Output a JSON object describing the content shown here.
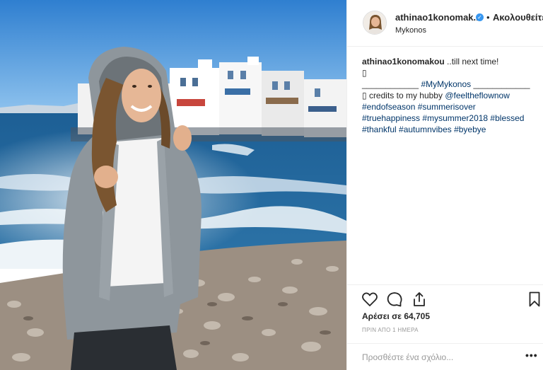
{
  "header": {
    "username": "athinao1konomak...",
    "verified_icon": "verified-check-icon",
    "separator": "•",
    "follow_label": "Ακολουθείτε",
    "location": "Mykonos"
  },
  "caption": {
    "username": "athinao1konomakou",
    "text": "..till next time!",
    "line2": "▯",
    "line3_pre": "____________",
    "line3_tag": "#MyMykonos",
    "line3_post": "____________",
    "line4_pre": "▯ credits to my hubby",
    "line4_mention": "@feeltheflownow",
    "line5": "#endofseason #summerisover",
    "line6": "#truehappiness #mysummer2018 #blessed",
    "line7": "#thankful #autumnvibes #byebye"
  },
  "actions": {
    "like_icon": "heart-icon",
    "comment_icon": "comment-icon",
    "share_icon": "share-icon",
    "save_icon": "bookmark-icon"
  },
  "likes": "Αρέσει σε 64,705",
  "timestamp": "ΠΡΙΝ ΑΠΟ 1 ΗΜΕΡΑ",
  "comment": {
    "placeholder": "Προσθέστε ένα σχόλιο...",
    "value": "",
    "more_label": "•••"
  }
}
